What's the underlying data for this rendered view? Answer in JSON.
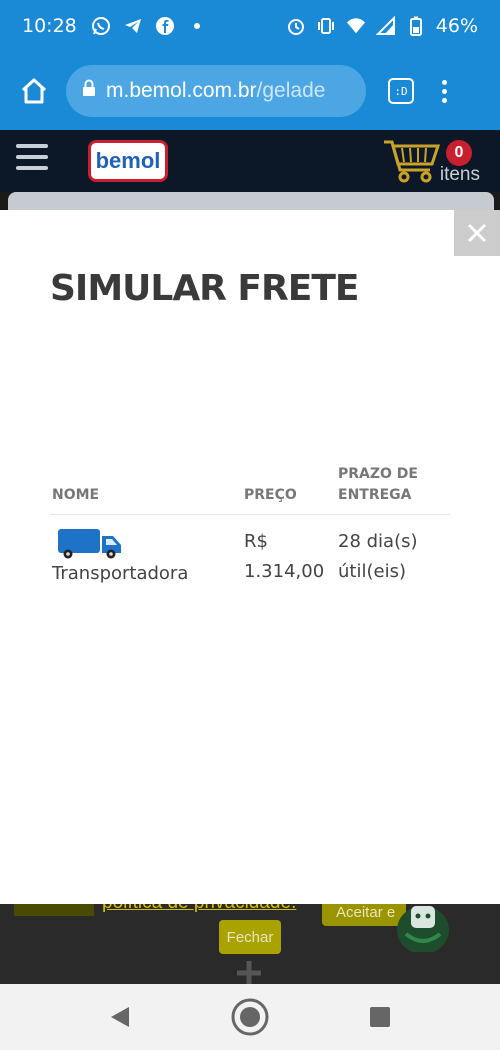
{
  "status_bar": {
    "time": "10:28",
    "battery": "46%",
    "notification_icons": [
      "whatsapp-icon",
      "telegram-icon",
      "facebook-icon",
      "dot-icon"
    ],
    "system_icons": [
      "alarm-icon",
      "vibrate-icon",
      "wifi-icon",
      "signal-icon",
      "battery-icon"
    ]
  },
  "browser": {
    "url_host": "m.bemol.com.br",
    "url_path": "/gelade",
    "tab_label": ":D"
  },
  "site": {
    "logo_text": "bemol",
    "cart_count": "0",
    "cart_label": "itens"
  },
  "modal": {
    "title": "SIMULAR FRETE",
    "close_symbol": "✕",
    "table": {
      "headers": [
        "NOME",
        "PREÇO",
        "PRAZO DE ENTREGA"
      ],
      "rows": [
        {
          "icon": "truck-icon",
          "name": "Transportadora",
          "price": "R$ 1.314,00",
          "delivery": "28 dia(s) útil(eis)"
        }
      ]
    }
  },
  "cookie_bar": {
    "link_text": "política de privacidade.",
    "accept_label": "Aceitar e",
    "close_label": "Fechar"
  },
  "colors": {
    "browser_blue": "#1a8ad6",
    "header_dark": "#0c1827",
    "brand_red": "#c8202f",
    "truck_blue": "#1e73c7",
    "cookie_yellow": "#a9a300"
  }
}
